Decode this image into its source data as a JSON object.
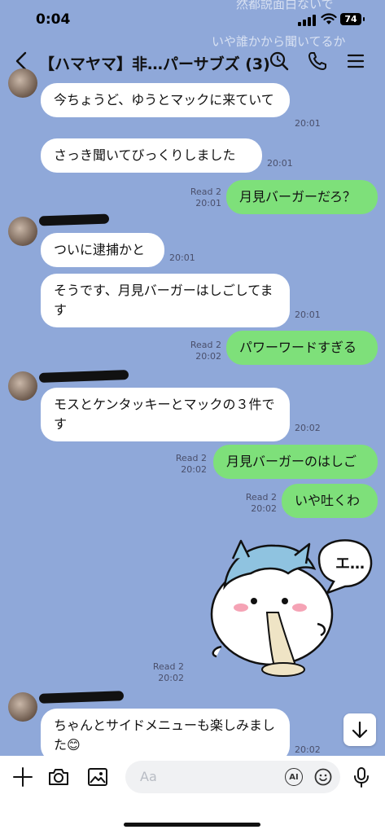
{
  "status": {
    "time": "0:04",
    "battery": "74",
    "banner_line1": "然都説面白ないで",
    "banner_line2": "いや誰かから聞いてるか"
  },
  "header": {
    "title": "【ハマヤマ】非…パーサブズ (3)"
  },
  "messages": [
    {
      "side": "in",
      "text": "今ちょうど、ゆうとマックに来ていて",
      "time": "20:01"
    },
    {
      "side": "in",
      "text": "さっき聞いてびっくりしました",
      "time": "20:01"
    },
    {
      "side": "out",
      "text": "月見バーガーだろ？",
      "read": "Read 2",
      "time": "20:01"
    },
    {
      "side": "in",
      "text": "ついに逮捕かと",
      "time": "20:01"
    },
    {
      "side": "in",
      "text": "そうです、月見バーガーはしごしてます",
      "time": "20:01"
    },
    {
      "side": "out",
      "text": "パワーワードすぎる",
      "read": "Read 2",
      "time": "20:02"
    },
    {
      "side": "in",
      "text": "モスとケンタッキーとマックの３件です",
      "time": "20:02"
    },
    {
      "side": "out",
      "text": "月見バーガーのはしご",
      "read": "Read 2",
      "time": "20:02"
    },
    {
      "side": "out",
      "text": "いや吐くわ",
      "read": "Read 2",
      "time": "20:02"
    },
    {
      "side": "out",
      "type": "sticker",
      "sticker_text": "エ…",
      "read": "Read 2",
      "time": "20:02"
    },
    {
      "side": "in",
      "text": "ちゃんとサイドメニューも楽しみました😊",
      "time": "20:02"
    }
  ],
  "input": {
    "placeholder": "Aa",
    "ai_label": "AI"
  },
  "colors": {
    "background": "#8fa8d9",
    "outgoing_bubble": "#7ee07a",
    "incoming_bubble": "#ffffff"
  },
  "icons": [
    "back-icon",
    "search-icon",
    "phone-icon",
    "menu-icon",
    "plus-icon",
    "camera-icon",
    "image-icon",
    "ai-icon",
    "emoji-icon",
    "mic-icon",
    "arrow-down-icon"
  ]
}
